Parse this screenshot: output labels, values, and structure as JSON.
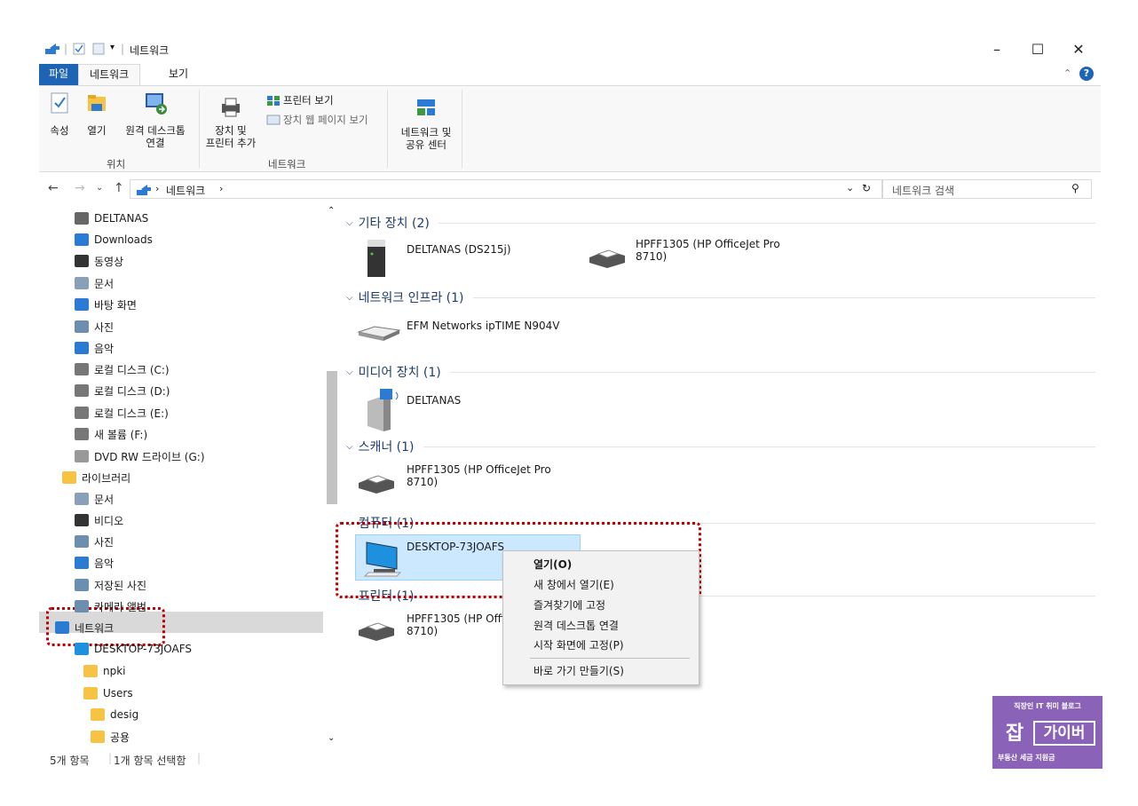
{
  "window": {
    "title": "네트워크"
  },
  "tabs": [
    "파일",
    "네트워크",
    "보기"
  ],
  "ribbon": {
    "location_group": {
      "label": "위치",
      "buttons": [
        "속성",
        "열기",
        "원격 데스크톱",
        "연결"
      ]
    },
    "network_group": {
      "label": "네트워크",
      "add_device": [
        "장치 및",
        "프린터 추가"
      ],
      "view_printers": "프린터 보기",
      "view_device_web": "장치 웹 페이지 보기"
    },
    "sharing_center": [
      "네트워크 및",
      "공유 센터"
    ]
  },
  "address": {
    "crumb": "네트워크",
    "search_placeholder": "네트워크 검색"
  },
  "nav": [
    {
      "label": "DELTANAS",
      "icon": "nas-icon"
    },
    {
      "label": "Downloads",
      "icon": "download-icon"
    },
    {
      "label": "동영상",
      "icon": "video-icon"
    },
    {
      "label": "문서",
      "icon": "document-icon"
    },
    {
      "label": "바탕 화면",
      "icon": "desktop-icon"
    },
    {
      "label": "사진",
      "icon": "picture-icon"
    },
    {
      "label": "음악",
      "icon": "music-icon"
    },
    {
      "label": "로컬 디스크 (C:)",
      "icon": "drive-icon"
    },
    {
      "label": "로컬 디스크 (D:)",
      "icon": "drive-icon"
    },
    {
      "label": "로컬 디스크 (E:)",
      "icon": "drive-icon"
    },
    {
      "label": "새 볼륨 (F:)",
      "icon": "drive-icon"
    },
    {
      "label": "DVD RW 드라이브 (G:)",
      "icon": "dvd-icon"
    },
    {
      "label": "라이브러리",
      "icon": "library-icon"
    },
    {
      "label": "문서",
      "icon": "document-icon"
    },
    {
      "label": "비디오",
      "icon": "video-icon"
    },
    {
      "label": "사진",
      "icon": "picture-icon"
    },
    {
      "label": "음악",
      "icon": "music-icon"
    },
    {
      "label": "저장된 사진",
      "icon": "picture-icon"
    },
    {
      "label": "카메라 앨범",
      "icon": "picture-icon"
    },
    {
      "label": "네트워크",
      "icon": "network-icon"
    },
    {
      "label": "DESKTOP-73JOAFS",
      "icon": "computer-icon"
    },
    {
      "label": "npki",
      "icon": "share-folder-icon"
    },
    {
      "label": "Users",
      "icon": "share-folder-icon"
    },
    {
      "label": "desig",
      "icon": "folder-icon"
    },
    {
      "label": "공용",
      "icon": "folder-icon"
    }
  ],
  "groups": [
    {
      "header": "기타 장치 (2)"
    },
    {
      "header": "네트워크 인프라 (1)"
    },
    {
      "header": "미디어 장치 (1)"
    },
    {
      "header": "스캐너 (1)"
    },
    {
      "header": "컴퓨터 (1)"
    },
    {
      "header": "프린터 (1)"
    }
  ],
  "devices": {
    "deltanas_ds215j": "DELTANAS (DS215j)",
    "hpff_other": [
      "HPFF1305 (HP OfficeJet Pro",
      "8710)"
    ],
    "router": "EFM Networks ipTIME N904V",
    "deltanas_media": "DELTANAS",
    "scanner": [
      "HPFF1305 (HP OfficeJet Pro",
      "8710)"
    ],
    "computer": "DESKTOP-73JOAFS",
    "printer": [
      "HPFF1305 (HP Offi",
      "8710)"
    ]
  },
  "context_menu": [
    "열기(O)",
    "새 창에서 열기(E)",
    "즐겨찾기에 고정",
    "원격 데스크톱 연결",
    "시작 화면에 고정(P)",
    "바로 가기 만들기(S)"
  ],
  "status": {
    "count": "5개 항목",
    "selected": "1개 항목 선택함"
  },
  "watermark": {
    "top": "직장인 IT 취미 블로그",
    "badge": "잡",
    "name": "가이버",
    "bottom": "부동산 세금 지원금"
  },
  "colors": {
    "file_tab": "#1e64b4",
    "highlight_box": "#c00000",
    "selection": "#cce8ff",
    "watermark": "#8a62b8"
  }
}
